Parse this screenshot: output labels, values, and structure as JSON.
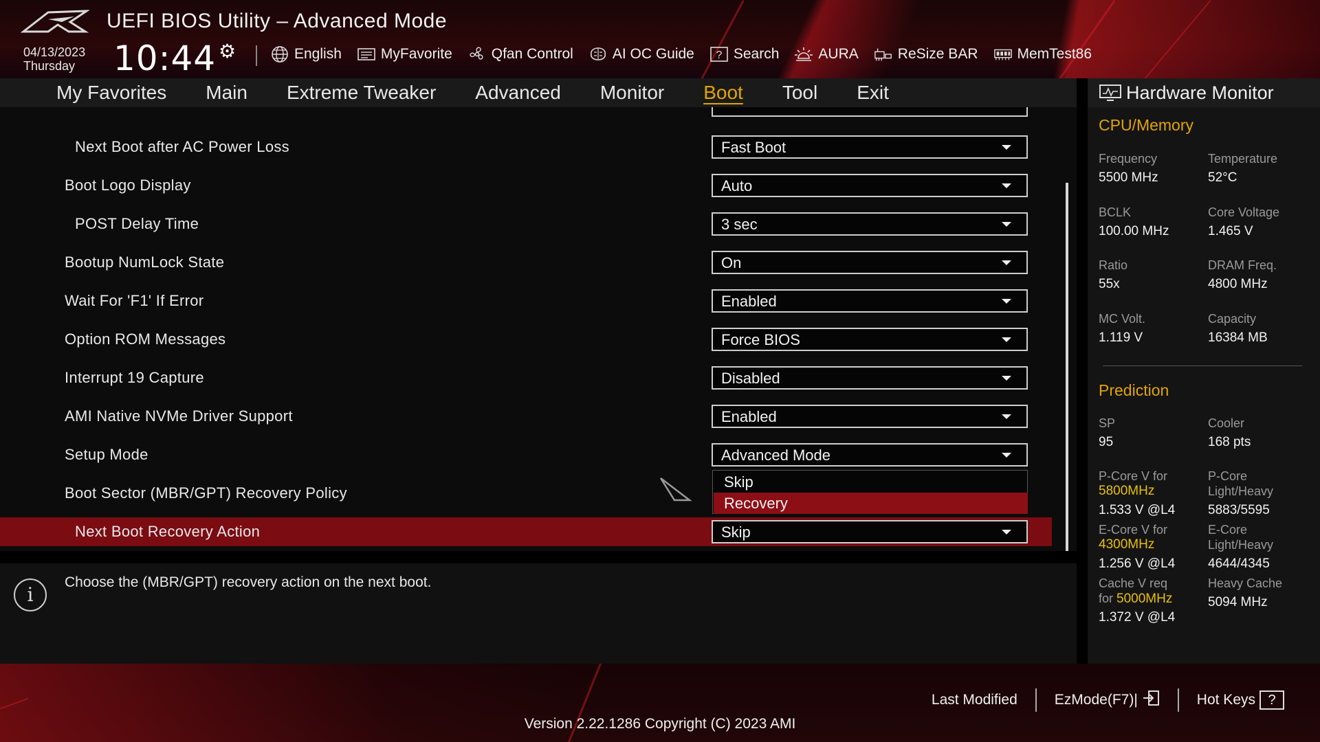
{
  "header": {
    "title": "UEFI BIOS Utility – Advanced Mode",
    "date": "04/13/2023",
    "day": "Thursday",
    "time": "10:44",
    "toolbar": [
      {
        "label": "English",
        "icon": "globe-icon"
      },
      {
        "label": "MyFavorite",
        "icon": "myfavorite-icon"
      },
      {
        "label": "Qfan Control",
        "icon": "fan-icon"
      },
      {
        "label": "AI OC Guide",
        "icon": "ai-oc-guide-icon"
      },
      {
        "label": "Search",
        "icon": "search-icon"
      },
      {
        "label": "AURA",
        "icon": "aura-icon"
      },
      {
        "label": "ReSize BAR",
        "icon": "resize-bar-icon"
      },
      {
        "label": "MemTest86",
        "icon": "memtest-icon"
      }
    ]
  },
  "tabs": [
    {
      "label": "My Favorites"
    },
    {
      "label": "Main"
    },
    {
      "label": "Extreme Tweaker"
    },
    {
      "label": "Advanced"
    },
    {
      "label": "Monitor"
    },
    {
      "label": "Boot",
      "active": true
    },
    {
      "label": "Tool"
    },
    {
      "label": "Exit"
    }
  ],
  "settings": [
    {
      "label": "Next Boot after AC Power Loss",
      "value": "Fast Boot"
    },
    {
      "label": "Boot Logo Display",
      "value": "Auto"
    },
    {
      "label": "POST Delay Time",
      "value": "3 sec"
    },
    {
      "label": "Bootup NumLock State",
      "value": "On"
    },
    {
      "label": "Wait For 'F1' If Error",
      "value": "Enabled"
    },
    {
      "label": "Option ROM Messages",
      "value": "Force BIOS"
    },
    {
      "label": "Interrupt 19 Capture",
      "value": "Disabled"
    },
    {
      "label": "AMI Native NVMe Driver Support",
      "value": "Enabled"
    },
    {
      "label": "Setup Mode",
      "value": "Advanced Mode"
    },
    {
      "label": "Boot Sector (MBR/GPT) Recovery Policy",
      "value": ""
    },
    {
      "label": "Next Boot Recovery Action",
      "value": "Skip"
    }
  ],
  "dropdown": {
    "options": [
      "Skip",
      "Recovery"
    ],
    "selected": "Recovery"
  },
  "help": {
    "text": "Choose the (MBR/GPT) recovery action on the next boot."
  },
  "hwmon": {
    "title": "Hardware Monitor",
    "cpu_section": "CPU/Memory",
    "frequency_label": "Frequency",
    "frequency": "5500 MHz",
    "temperature_label": "Temperature",
    "temperature": "52°C",
    "bclk_label": "BCLK",
    "bclk": "100.00 MHz",
    "core_voltage_label": "Core Voltage",
    "core_voltage": "1.465 V",
    "ratio_label": "Ratio",
    "ratio": "55x",
    "dram_freq_label": "DRAM Freq.",
    "dram_freq": "4800 MHz",
    "mc_volt_label": "MC Volt.",
    "mc_volt": "1.119 V",
    "capacity_label": "Capacity",
    "capacity": "16384 MB",
    "prediction_section": "Prediction",
    "sp_label": "SP",
    "sp": "95",
    "cooler_label": "Cooler",
    "cooler": "168 pts",
    "pcore_v_label": "P-Core V for",
    "pcore_v_freq": "5800MHz",
    "pcore_v": "1.533 V @L4",
    "pcore_lh_label1": "P-Core",
    "pcore_lh_label2": "Light/Heavy",
    "pcore_lh": "5883/5595",
    "ecore_v_label": "E-Core V for",
    "ecore_v_freq": "4300MHz",
    "ecore_v": "1.256 V @L4",
    "ecore_lh_label1": "E-Core",
    "ecore_lh_label2": "Light/Heavy",
    "ecore_lh": "4644/4345",
    "cache_v_label": "Cache V req",
    "cache_v_for": "for",
    "cache_v_freq": "5000MHz",
    "cache_v": "1.372 V @L4",
    "heavy_cache_label": "Heavy Cache",
    "heavy_cache": "5094 MHz"
  },
  "footer": {
    "last_modified": "Last Modified",
    "ezmode": "EzMode(F7)|",
    "hotkeys": "Hot Keys",
    "hotkeys_key": "?",
    "version": "Version 2.22.1286 Copyright (C) 2023 AMI"
  },
  "colors": {
    "accent": "#e2a400",
    "highlight_row": "#7a0c12",
    "dropdown_selected": "#8d0f16",
    "value_yellow": "#e8c000"
  }
}
